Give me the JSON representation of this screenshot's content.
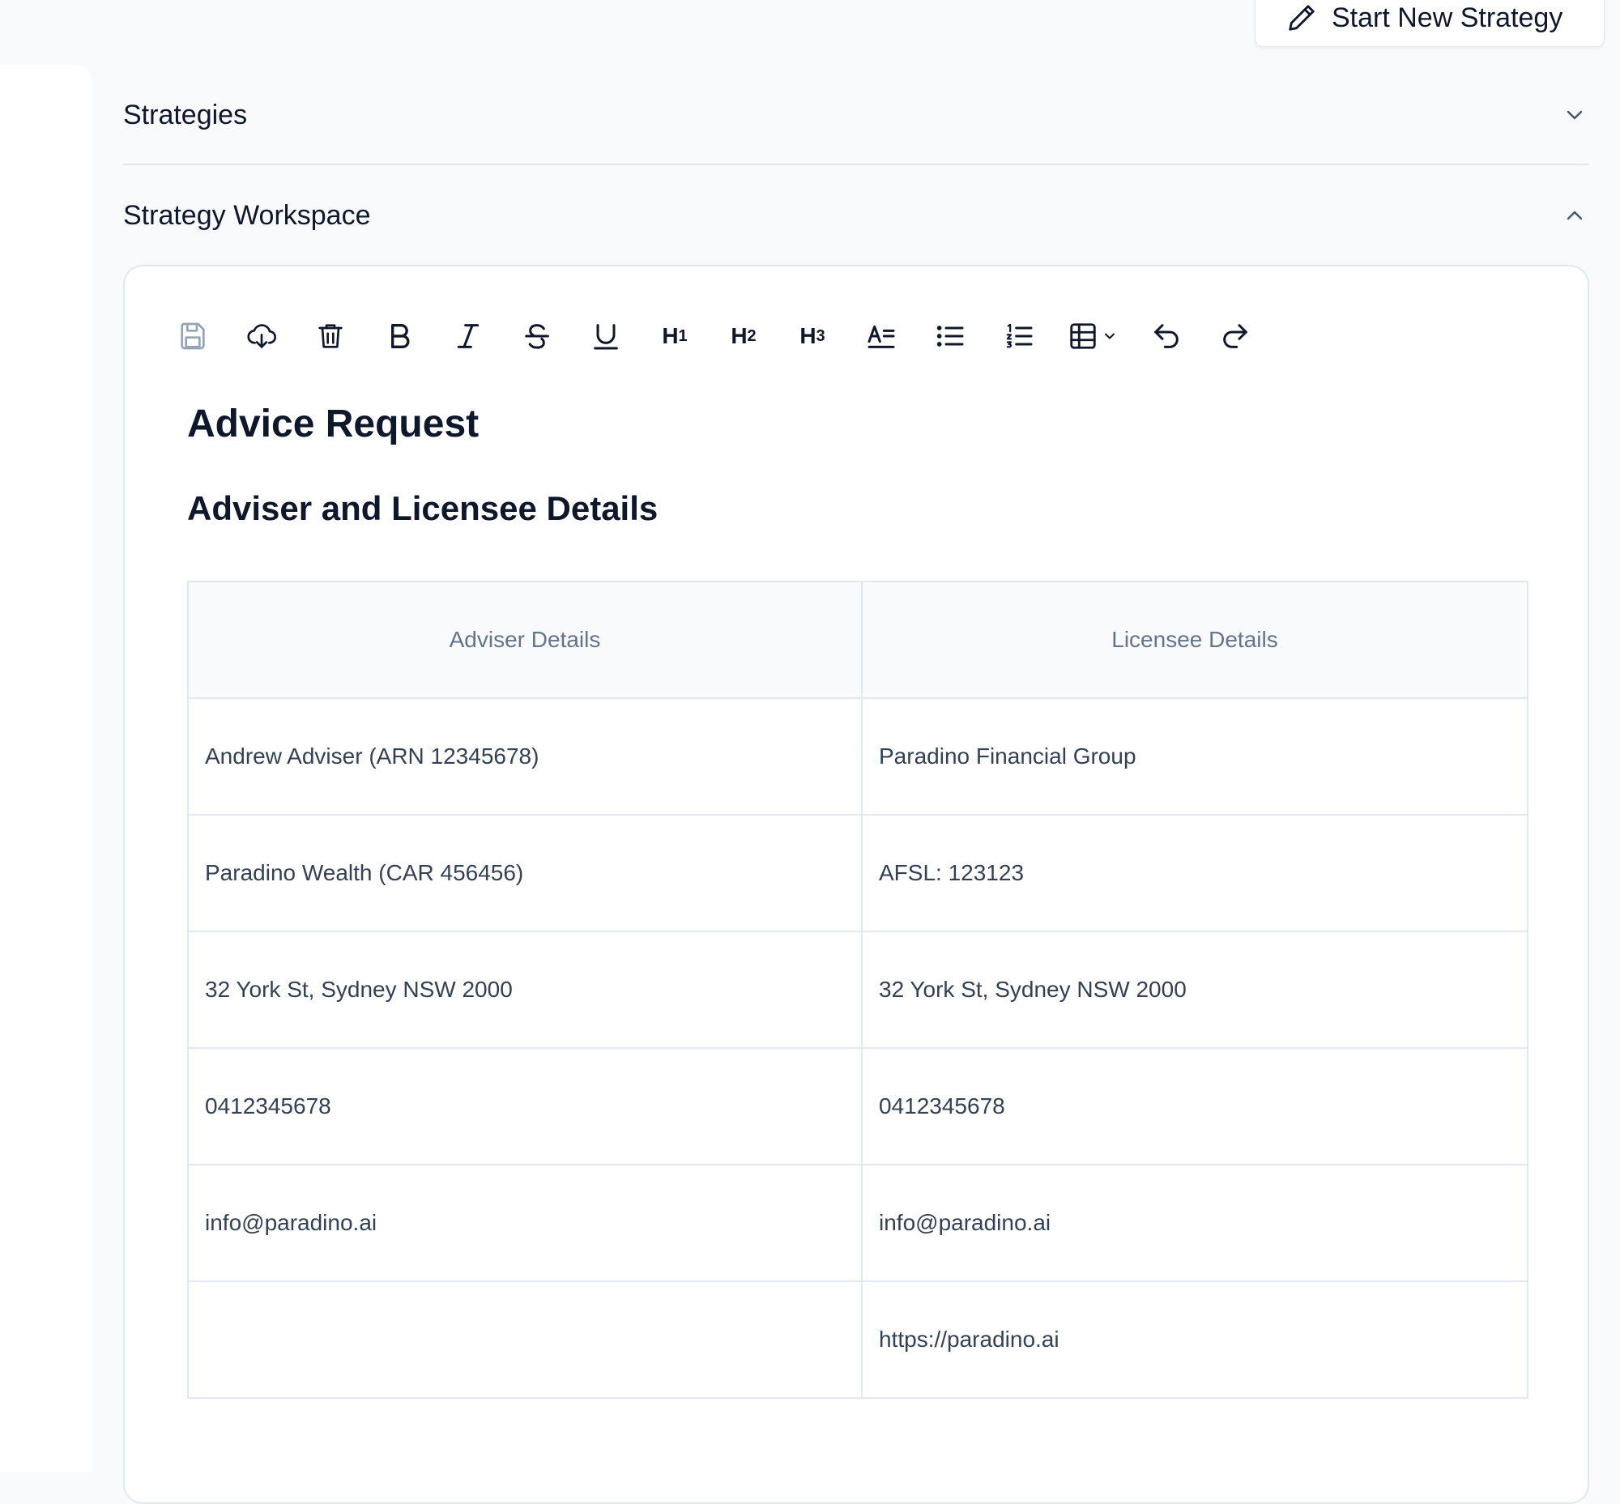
{
  "header": {
    "new_strategy_button": "Start New Strategy"
  },
  "sections": {
    "strategies": {
      "title": "Strategies",
      "state": "collapsed"
    },
    "workspace": {
      "title": "Strategy Workspace",
      "state": "expanded"
    }
  },
  "toolbar": {
    "items": [
      {
        "icon": "save-icon"
      },
      {
        "icon": "cloud-download-icon"
      },
      {
        "icon": "trash-icon"
      },
      {
        "icon": "bold-icon"
      },
      {
        "icon": "italic-icon"
      },
      {
        "icon": "strikethrough-icon"
      },
      {
        "icon": "underline-icon"
      },
      {
        "icon": "heading-1-icon",
        "text": "H1"
      },
      {
        "icon": "heading-2-icon",
        "text": "H2"
      },
      {
        "icon": "heading-3-icon",
        "text": "H3"
      },
      {
        "icon": "text-format-icon"
      },
      {
        "icon": "bullet-list-icon"
      },
      {
        "icon": "numbered-list-icon"
      },
      {
        "icon": "table-icon"
      },
      {
        "icon": "undo-icon"
      },
      {
        "icon": "redo-icon"
      }
    ]
  },
  "document": {
    "title": "Advice Request",
    "section_heading": "Adviser and Licensee Details",
    "table": {
      "headers": [
        "Adviser Details",
        "Licensee Details"
      ],
      "rows": [
        [
          "Andrew Adviser (ARN 12345678)",
          "Paradino Financial Group"
        ],
        [
          "Paradino Wealth (CAR 456456)",
          "AFSL: 123123"
        ],
        [
          "32 York St, Sydney NSW 2000",
          "32 York St, Sydney NSW 2000"
        ],
        [
          "0412345678",
          "0412345678"
        ],
        [
          "info@paradino.ai",
          "info@paradino.ai"
        ],
        [
          "",
          "https://paradino.ai"
        ]
      ]
    }
  },
  "colors": {
    "page_background": "#f8fafc",
    "card_background": "#ffffff",
    "border": "#e2e8f0",
    "text_primary": "#0f172a",
    "text_muted": "#64748b"
  }
}
